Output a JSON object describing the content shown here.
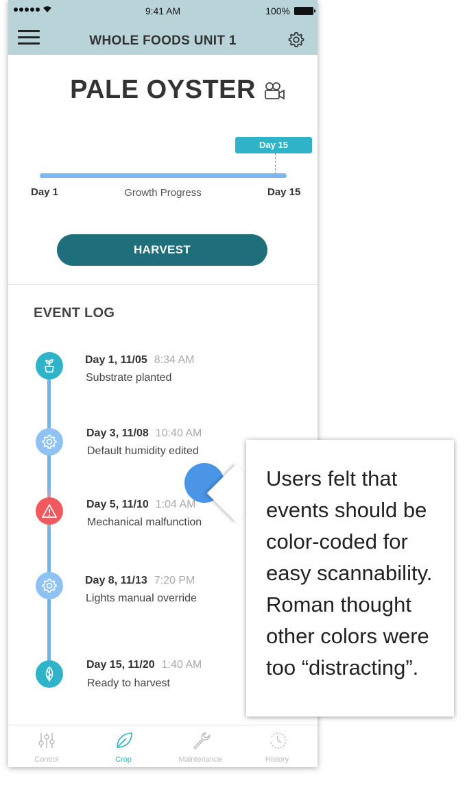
{
  "status_bar": {
    "time": "9:41 AM",
    "battery": "100%"
  },
  "header": {
    "title": "WHOLE FOODS UNIT 1"
  },
  "crop": {
    "name": "PALE OYSTER"
  },
  "progress": {
    "current_label": "Day 15",
    "start_label": "Day 1",
    "title": "Growth Progress",
    "end_label": "Day 15",
    "value_fraction": 1.0
  },
  "harvest_button": {
    "label": "HARVEST"
  },
  "event_log": {
    "title": "EVENT LOG",
    "events": [
      {
        "date": "Day 1, 11/05",
        "time": "8:34 AM",
        "description": "Substrate planted",
        "icon": "plant-pot-icon",
        "color": "#2fb3c9"
      },
      {
        "date": "Day 3, 11/08",
        "time": "10:40 AM",
        "description": "Default humidity edited",
        "icon": "gear-icon",
        "color": "#8ec2f2"
      },
      {
        "date": "Day 5, 11/10",
        "time": "1:04 AM",
        "description": "Mechanical malfunction",
        "icon": "warning-icon",
        "color": "#f0595e"
      },
      {
        "date": "Day 8, 11/13",
        "time": "7:20 PM",
        "description": "Lights manual override",
        "icon": "gear-icon",
        "color": "#8ec2f2"
      },
      {
        "date": "Day 15, 11/20",
        "time": "1:40 AM",
        "description": "Ready to harvest",
        "icon": "leaf-icon",
        "color": "#2fb3c9"
      }
    ]
  },
  "tab_bar": {
    "tabs": [
      {
        "label": "Control",
        "icon": "sliders-icon",
        "active": false
      },
      {
        "label": "Crop",
        "icon": "leaf-icon",
        "active": true
      },
      {
        "label": "Maintenance",
        "icon": "wrench-icon",
        "active": false
      },
      {
        "label": "History",
        "icon": "clock-icon",
        "active": false
      }
    ]
  },
  "annotation": {
    "text": "Users felt that events should be color-coded for easy scannability. Roman thought other colors were too “distracting”."
  },
  "colors": {
    "header_bg": "#b9d4d9",
    "accent_teal": "#2fb3c9",
    "button_dark_teal": "#1e6e7c",
    "progress_blue": "#7fb6f2",
    "warning_red": "#f0595e"
  }
}
